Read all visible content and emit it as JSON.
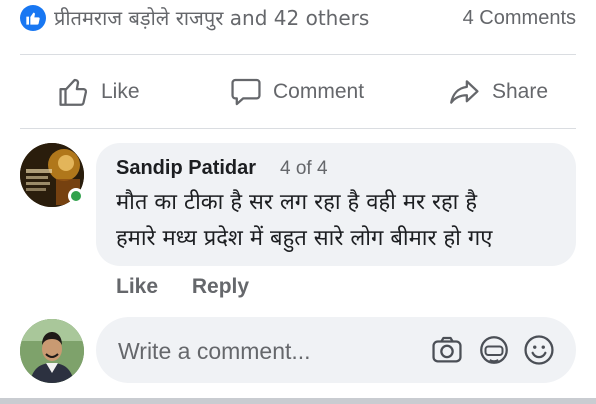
{
  "reactions": {
    "reactors_text": "प्रीतमराज बड़ोले राजपुर and 42 others",
    "comments_count": "4 Comments"
  },
  "actions": {
    "like": "Like",
    "comment": "Comment",
    "share": "Share"
  },
  "comment": {
    "author": "Sandip Patidar",
    "position": "4 of 4",
    "line1": "मौत का टीका है सर लग रहा है वही मर रहा है",
    "line2": "हमारे मध्य प्रदेश में बहुत सारे लोग बीमार हो गए",
    "like_label": "Like",
    "reply_label": "Reply",
    "online_color": "#31a24c"
  },
  "composer": {
    "placeholder": "Write a comment...",
    "icons": [
      "camera-icon",
      "gif-icon",
      "emoji-icon"
    ]
  },
  "colors": {
    "accent": "#1877f2",
    "muted_text": "#65676b",
    "bubble_bg": "#f0f2f5"
  }
}
